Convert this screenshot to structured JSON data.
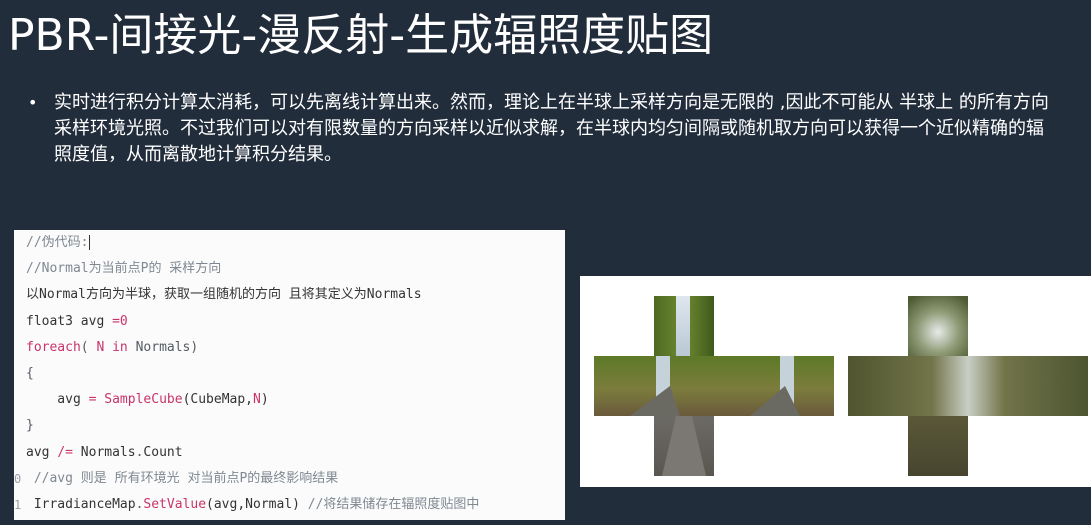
{
  "slide": {
    "title": "PBR-间接光-漫反射-生成辐照度贴图",
    "bullets": [
      "实时进行积分计算太消耗，可以先离线计算出来。然而，理论上在半球上采样方向是无限的 ,因此不可能从 半球上 的所有方向采样环境光照。不过我们可以对有限数量的方向采样以近似求解，在半球内均匀间隔或随机取方向可以获得一个近似精确的辐照度值，从而离散地计算积分结果。"
    ]
  },
  "code": {
    "lines": [
      {
        "segments": [
          {
            "t": "//伪代码:",
            "k": "c"
          }
        ],
        "cursor": true
      },
      {
        "segments": [
          {
            "t": "//Normal为当前点P的 采样方向",
            "k": "c"
          }
        ]
      },
      {
        "segments": [
          {
            "t": "以Normal方向为半球，获取一组随机的方向 且将其定义为Normals",
            "k": ""
          }
        ]
      },
      {
        "segments": [
          {
            "t": "float3 avg ",
            "k": ""
          },
          {
            "t": "=",
            "k": "k"
          },
          {
            "t": "0",
            "k": "k"
          }
        ]
      },
      {
        "segments": [
          {
            "t": "foreach",
            "k": "k"
          },
          {
            "t": "( ",
            "k": "p"
          },
          {
            "t": "N",
            "k": "k"
          },
          {
            "t": " in",
            "k": "k"
          },
          {
            "t": " Normals)",
            "k": "p"
          }
        ]
      },
      {
        "segments": [
          {
            "t": "{",
            "k": "p"
          }
        ]
      },
      {
        "segments": [
          {
            "t": "    avg ",
            "k": ""
          },
          {
            "t": "=",
            "k": "k"
          },
          {
            "t": " ",
            "k": ""
          },
          {
            "t": "SampleCube",
            "k": "k"
          },
          {
            "t": "(CubeMap,",
            "k": ""
          },
          {
            "t": "N",
            "k": "k"
          },
          {
            "t": ")",
            "k": ""
          }
        ]
      },
      {
        "segments": [
          {
            "t": "}",
            "k": "p"
          }
        ]
      },
      {
        "segments": [
          {
            "t": "avg ",
            "k": ""
          },
          {
            "t": "/=",
            "k": "k"
          },
          {
            "t": " Normals",
            "k": ""
          },
          {
            "t": ".",
            "k": "p"
          },
          {
            "t": "Count",
            "k": ""
          }
        ]
      },
      {
        "ln": "0",
        "segments": [
          {
            "t": " //avg 则是 所有环境光 对当前点P的最终影响结果",
            "k": "c"
          }
        ]
      },
      {
        "ln": "1",
        "segments": [
          {
            "t": " IrradianceMap",
            "k": ""
          },
          {
            "t": ".",
            "k": "p"
          },
          {
            "t": "SetValue",
            "k": "k"
          },
          {
            "t": "(avg,Normal) ",
            "k": ""
          },
          {
            "t": "//将结果储存在辐照度贴图中",
            "k": "c"
          }
        ]
      }
    ]
  },
  "images": {
    "cubemap_icon": "environment-cubemap-cross",
    "irradiance_icon": "irradiance-map-cross"
  },
  "colors": {
    "background": "#222d3c",
    "text": "#ffffff",
    "code_keyword": "#c8336a",
    "code_comment": "#7f8891"
  }
}
